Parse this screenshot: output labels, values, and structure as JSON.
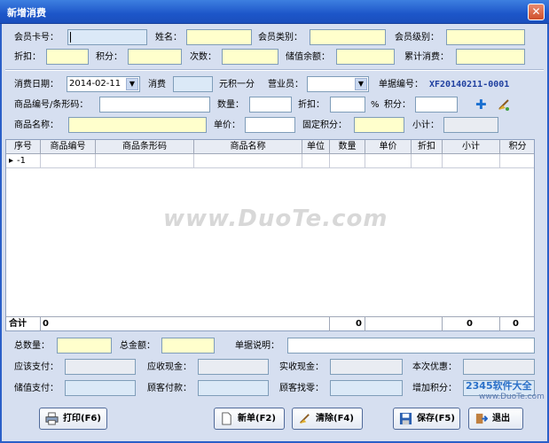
{
  "window": {
    "title": "新增消费",
    "close": "✕"
  },
  "member": {
    "card_label": "会员卡号：",
    "name_label": "姓名：",
    "type_label": "会员类别：",
    "level_label": "会员级别：",
    "discount_label": "折扣：",
    "points_label": "积分：",
    "times_label": "次数：",
    "balance_label": "储值余额：",
    "total_label": "累计消费："
  },
  "order": {
    "date_label": "消费日期：",
    "date_value": "2014-02-11",
    "consume_label": "消费",
    "rate_label": "元积一分",
    "clerk_label": "营业员：",
    "bill_label": "单据编号：",
    "bill_value": "XF20140211-0001",
    "code_label": "商品编号/条形码：",
    "qty_label": "数量：",
    "disc_label": "折扣：",
    "pct": "%",
    "pts_label": "积分：",
    "name_label": "商品名称：",
    "price_label": "单价：",
    "fixed_label": "固定积分：",
    "subtotal_label": "小计："
  },
  "grid": {
    "headers": [
      "序号",
      "商品编号",
      "商品条形码",
      "商品名称",
      "单位",
      "数量",
      "单价",
      "折扣",
      "小计",
      "积分"
    ],
    "row_marker": "▸",
    "row_no": "-1",
    "footer_label": "合计",
    "footer_no": "0",
    "footer_qty": "0",
    "footer_subtotal": "0",
    "footer_points": "0"
  },
  "watermark": "www.DuoTe.com",
  "summary": {
    "count_label": "总数量：",
    "amount_label": "总金额：",
    "note_label": "单据说明：",
    "due_label": "应该支付：",
    "cash_due_label": "应收现金：",
    "cash_recv_label": "实收现金：",
    "discount_label": "本次优惠：",
    "stored_label": "储值支付：",
    "paid_label": "顾客付款：",
    "change_label": "顾客找零：",
    "add_points_label": "增加积分："
  },
  "buttons": {
    "print": "打印(F6)",
    "new": "新单(F2)",
    "clear": "清除(F4)",
    "save": "保存(F5)",
    "exit": "退出"
  },
  "brand": {
    "logo_text": "2345软件大全",
    "site": "www.DuoTe.com"
  }
}
